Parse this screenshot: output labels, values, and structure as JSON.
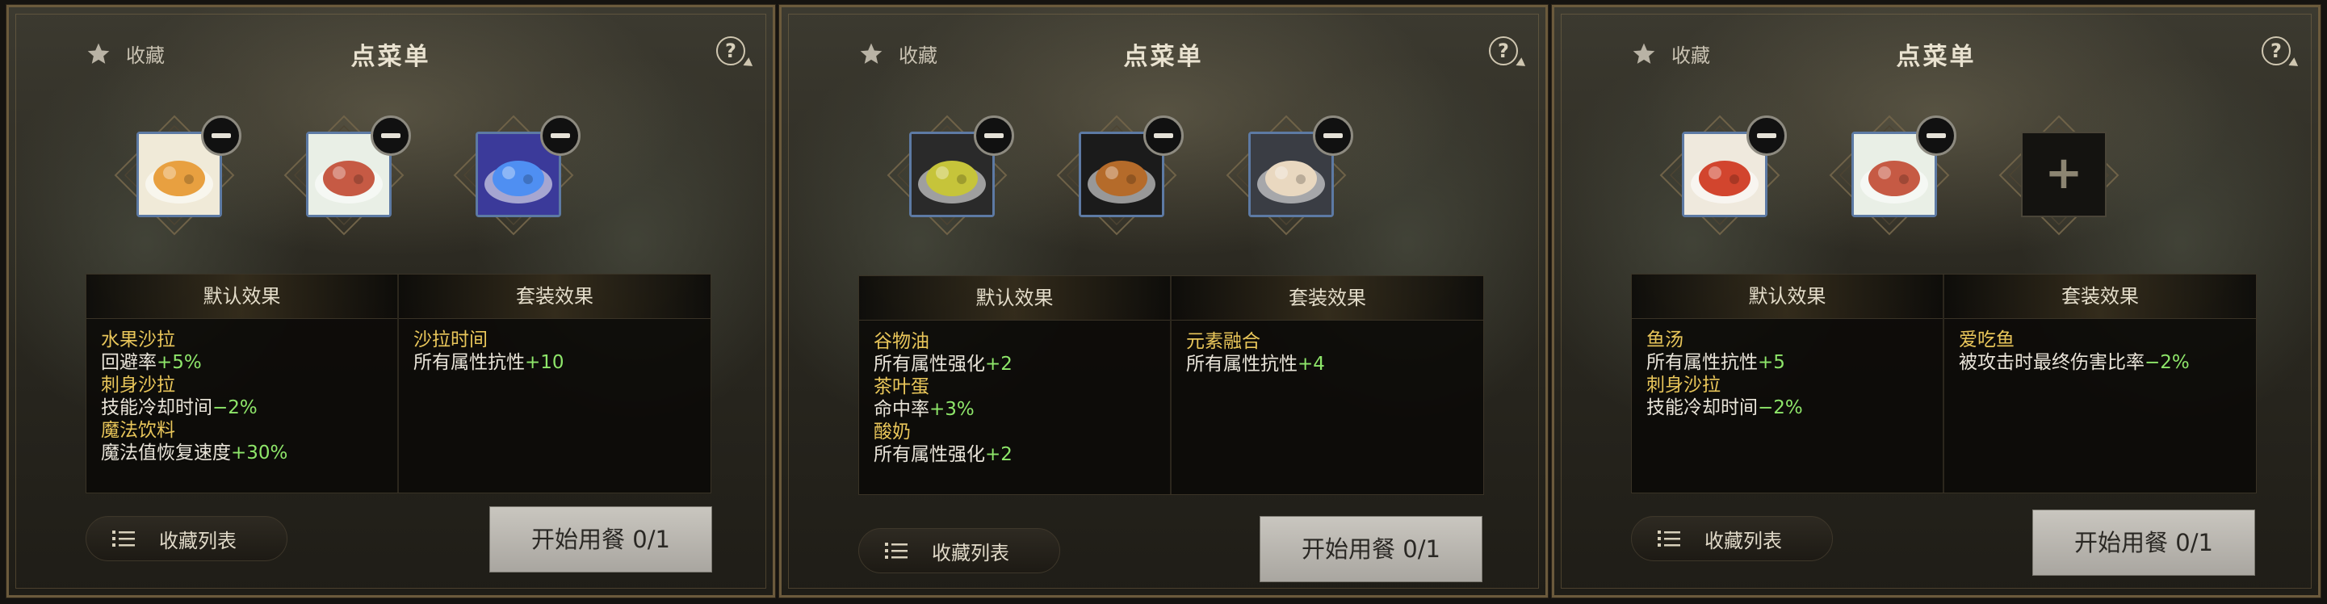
{
  "panels": [
    {
      "favorite_label": "收藏",
      "title": "点菜单",
      "help": "?",
      "slots": [
        {
          "food": "水果沙拉",
          "icon_name": "fruit-salad-icon",
          "color": "#e8a040",
          "bg": "#f0ead8"
        },
        {
          "food": "刺身沙拉",
          "icon_name": "sashimi-salad-icon",
          "color": "#c65a44",
          "bg": "#e9efe6"
        },
        {
          "food": "魔法饮料",
          "icon_name": "magic-drink-icon",
          "color": "#4f8ff2",
          "bg": "#3b3a9a"
        }
      ],
      "default_header": "默认效果",
      "set_header": "套装效果",
      "default_effects": [
        {
          "name": "水果沙拉",
          "stat": "回避率",
          "value": "+5%"
        },
        {
          "name": "刺身沙拉",
          "stat": "技能冷却时间",
          "value": "−2%"
        },
        {
          "name": "魔法饮料",
          "stat": "魔法值恢复速度",
          "value": "+30%"
        }
      ],
      "set_effects": [
        {
          "name": "沙拉时间",
          "stat": "所有属性抗性",
          "value": "+10"
        }
      ],
      "collect_label": "收藏列表",
      "start_label": "开始用餐 0/1"
    },
    {
      "favorite_label": "收藏",
      "title": "点菜单",
      "help": "?",
      "slots": [
        {
          "food": "谷物油",
          "icon_name": "grain-oil-icon",
          "color": "#c6c43a",
          "bg": "#2a2a2a"
        },
        {
          "food": "茶叶蛋",
          "icon_name": "tea-egg-icon",
          "color": "#b56b2a",
          "bg": "#1b1b1b"
        },
        {
          "food": "酸奶",
          "icon_name": "yogurt-icon",
          "color": "#e9d8c0",
          "bg": "#3a3d44"
        }
      ],
      "default_header": "默认效果",
      "set_header": "套装效果",
      "default_effects": [
        {
          "name": "谷物油",
          "stat": "所有属性强化",
          "value": "+2"
        },
        {
          "name": "茶叶蛋",
          "stat": "命中率",
          "value": "+3%"
        },
        {
          "name": "酸奶",
          "stat": "所有属性强化",
          "value": "+2"
        }
      ],
      "set_effects": [
        {
          "name": "元素融合",
          "stat": "所有属性抗性",
          "value": "+4"
        }
      ],
      "collect_label": "收藏列表",
      "start_label": "开始用餐 0/1"
    },
    {
      "favorite_label": "收藏",
      "title": "点菜单",
      "help": "?",
      "slots": [
        {
          "food": "鱼汤",
          "icon_name": "fish-soup-icon",
          "color": "#d2452e",
          "bg": "#efe9dd"
        },
        {
          "food": "刺身沙拉",
          "icon_name": "sashimi-salad-icon",
          "color": "#c65a44",
          "bg": "#e9efe6"
        },
        {
          "food": "",
          "icon_name": "plus-icon",
          "empty": true
        }
      ],
      "default_header": "默认效果",
      "set_header": "套装效果",
      "default_effects": [
        {
          "name": "鱼汤",
          "stat": "所有属性抗性",
          "value": "+5"
        },
        {
          "name": "刺身沙拉",
          "stat": "技能冷却时间",
          "value": "−2%"
        }
      ],
      "set_effects": [
        {
          "name": "爱吃鱼",
          "stat": "被攻击时最终伤害比率",
          "value": "−2%"
        }
      ],
      "collect_label": "收藏列表",
      "start_label": "开始用餐 0/1"
    }
  ]
}
